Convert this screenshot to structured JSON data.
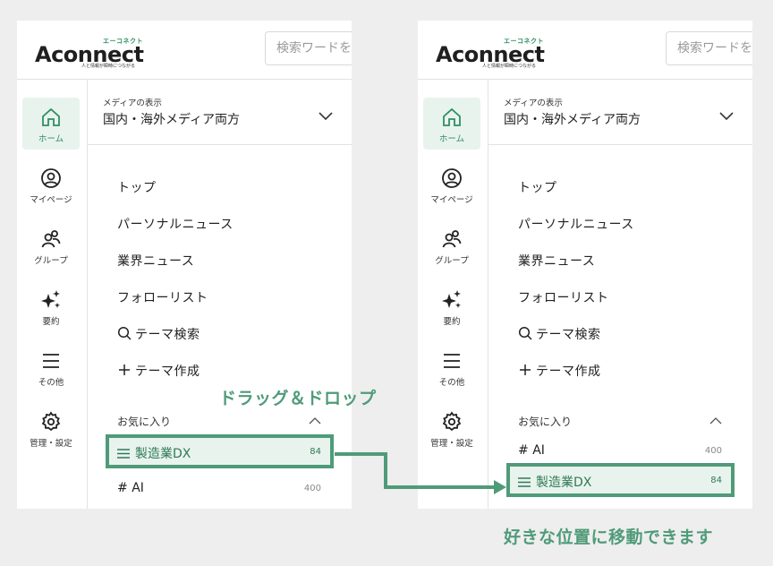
{
  "brand": {
    "name": "Aconnect",
    "reading": "エーコネクト",
    "tagline": "人と情報が瞬時につながる",
    "accent_color": "#4f9b79",
    "accent_light": "#e9f3ee"
  },
  "search": {
    "placeholder": "検索ワードを"
  },
  "rail": [
    {
      "label": "ホーム",
      "icon": "home-icon",
      "active": true
    },
    {
      "label": "マイページ",
      "icon": "user-circle-icon",
      "active": false
    },
    {
      "label": "グループ",
      "icon": "group-icon",
      "active": false
    },
    {
      "label": "要約",
      "icon": "sparkle-icon",
      "active": false
    },
    {
      "label": "その他",
      "icon": "menu-icon",
      "active": false
    },
    {
      "label": "管理・設定",
      "icon": "gear-icon",
      "active": false
    }
  ],
  "media_display": {
    "label": "メディアの表示",
    "value": "国内・海外メディア両方"
  },
  "nav": [
    {
      "label": "トップ",
      "icon": ""
    },
    {
      "label": "パーソナルニュース",
      "icon": ""
    },
    {
      "label": "業界ニュース",
      "icon": ""
    },
    {
      "label": "フォローリスト",
      "icon": ""
    },
    {
      "label": "テーマ検索",
      "icon": "search-icon"
    },
    {
      "label": "テーマ作成",
      "icon": "plus-icon"
    }
  ],
  "favorites": {
    "title": "お気に入り",
    "items": [
      {
        "name": "製造業DX",
        "count": "84"
      },
      {
        "name": "AI",
        "count": "400"
      }
    ]
  },
  "captions": {
    "drag": "ドラッグ＆ドロップ",
    "result": "好きな位置に移動できます"
  }
}
